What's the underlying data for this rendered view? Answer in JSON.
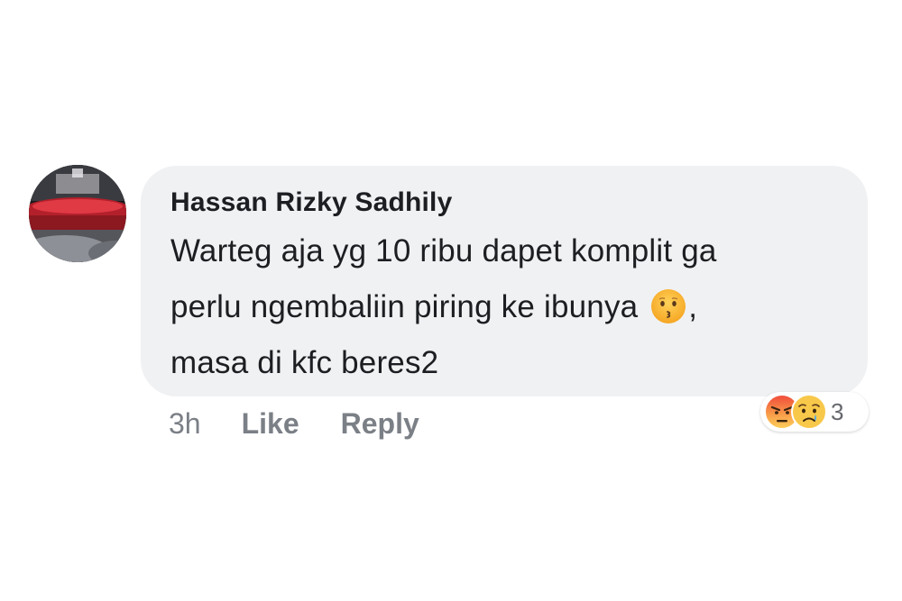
{
  "comment": {
    "author": "Hassan Rizky Sadhily",
    "text_line1": "Warteg aja yg 10 ribu dapet komplit ga",
    "text_line2_before_emoji": "perlu ngembaliin piring ke ibunya",
    "text_line2_after_emoji": ",",
    "text_line3": "masa di kfc beres2",
    "inline_emoji": "kissing-face-emoji"
  },
  "actions": {
    "time": "3h",
    "like_label": "Like",
    "reply_label": "Reply"
  },
  "reactions": {
    "icons": [
      "angry-reaction-icon",
      "sad-reaction-icon"
    ],
    "count": "3"
  },
  "colors": {
    "bubble_bg": "#f0f1f3",
    "text": "#1c1e21",
    "muted": "#7b7f86"
  }
}
